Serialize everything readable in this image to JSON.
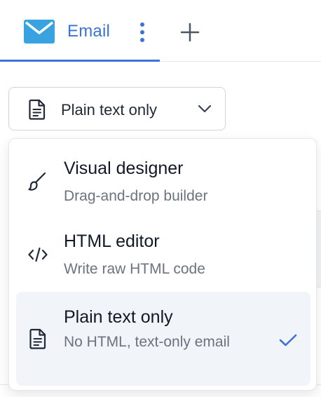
{
  "tabs": [
    {
      "label": "Email",
      "icon": "mail-icon",
      "active": true
    }
  ],
  "tab_actions": {
    "more_icon": "more-vertical-icon",
    "add_icon": "plus-icon"
  },
  "format_select": {
    "selected_label": "Plain text only",
    "icon": "document-icon",
    "chevron_icon": "chevron-down-icon"
  },
  "menu": {
    "options": [
      {
        "title": "Visual designer",
        "description": "Drag-and-drop builder",
        "icon": "paintbrush-icon",
        "selected": false
      },
      {
        "title": "HTML editor",
        "description": "Write raw HTML code",
        "icon": "code-icon",
        "selected": false
      },
      {
        "title": "Plain text only",
        "description": "No HTML, text-only email",
        "icon": "document-icon",
        "selected": true
      }
    ]
  },
  "colors": {
    "accent": "#3b73d6",
    "selected_bg": "#f1f4f9",
    "muted_text": "#6b7280",
    "mail_icon": "#38a3e0"
  }
}
